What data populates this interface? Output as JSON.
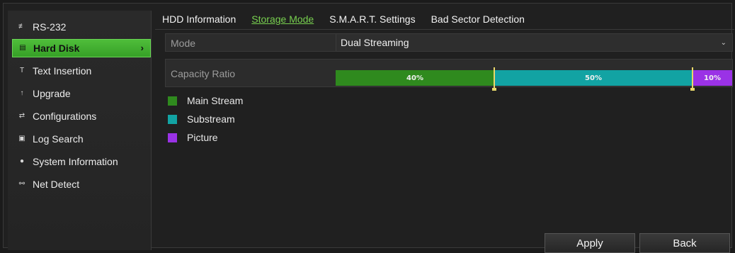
{
  "sidebar": {
    "items": [
      {
        "label": "RS-232",
        "icon": "rs232-icon",
        "glyph": "≢"
      },
      {
        "label": "Hard Disk",
        "icon": "hard-disk-icon",
        "glyph": "▤",
        "active": true
      },
      {
        "label": "Text Insertion",
        "icon": "text-insertion-icon",
        "glyph": "T"
      },
      {
        "label": "Upgrade",
        "icon": "upgrade-icon",
        "glyph": "↑"
      },
      {
        "label": "Configurations",
        "icon": "configurations-icon",
        "glyph": "⇄"
      },
      {
        "label": "Log Search",
        "icon": "log-search-icon",
        "glyph": "▣"
      },
      {
        "label": "System Information",
        "icon": "info-icon",
        "glyph": "●"
      },
      {
        "label": "Net Detect",
        "icon": "net-detect-icon",
        "glyph": "⚯"
      }
    ]
  },
  "tabs": [
    "HDD Information",
    "Storage Mode",
    "S.M.A.R.T. Settings",
    "Bad Sector Detection"
  ],
  "active_tab": "Storage Mode",
  "mode": {
    "label": "Mode",
    "value": "Dual Streaming"
  },
  "capacity": {
    "label": "Capacity Ratio",
    "segments": [
      {
        "name": "Main Stream",
        "percent": 40,
        "text": "40%",
        "color": "#2f8a1e"
      },
      {
        "name": "Substream",
        "percent": 50,
        "text": "50%",
        "color": "#12a3a3"
      },
      {
        "name": "Picture",
        "percent": 10,
        "text": "10%",
        "color": "#9a32e6"
      }
    ]
  },
  "buttons": {
    "apply": "Apply",
    "back": "Back"
  },
  "colors": {
    "accent_green": "#4fbd3a",
    "active_tab": "#78d04f"
  }
}
